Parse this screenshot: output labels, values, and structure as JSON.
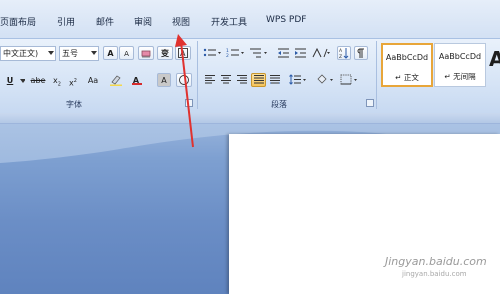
{
  "menu_tabs": [
    "页面布局",
    "引用",
    "邮件",
    "审阅",
    "视图",
    "开发工具",
    "WPS PDF"
  ],
  "font_group": {
    "label": "字体",
    "font_name": "中文正文)",
    "font_size": "五号",
    "grow_label": "A",
    "shrink_label": "A",
    "pinyin_label": "变",
    "underline_label": "U",
    "strike_label": "abe",
    "subscript_label": "x",
    "superscript_label": "x",
    "case_label": "Aa",
    "font_color_label": "A",
    "char_shade_label": "A"
  },
  "paragraph_group": {
    "label": "段落"
  },
  "styles": [
    {
      "sample": "AaBbCcDd",
      "name": "正文",
      "selected": true
    },
    {
      "sample": "AaBbCcDd",
      "name": "无间隔",
      "selected": false
    }
  ],
  "big_style_sample": "A",
  "watermark": {
    "text": "Jingyan.baidu.com",
    "sub": "jingyan.baidu.com"
  },
  "colors": {
    "arrow": "#e0322f",
    "highlight": "#f5d84b",
    "font_color": "#d62b2b"
  }
}
